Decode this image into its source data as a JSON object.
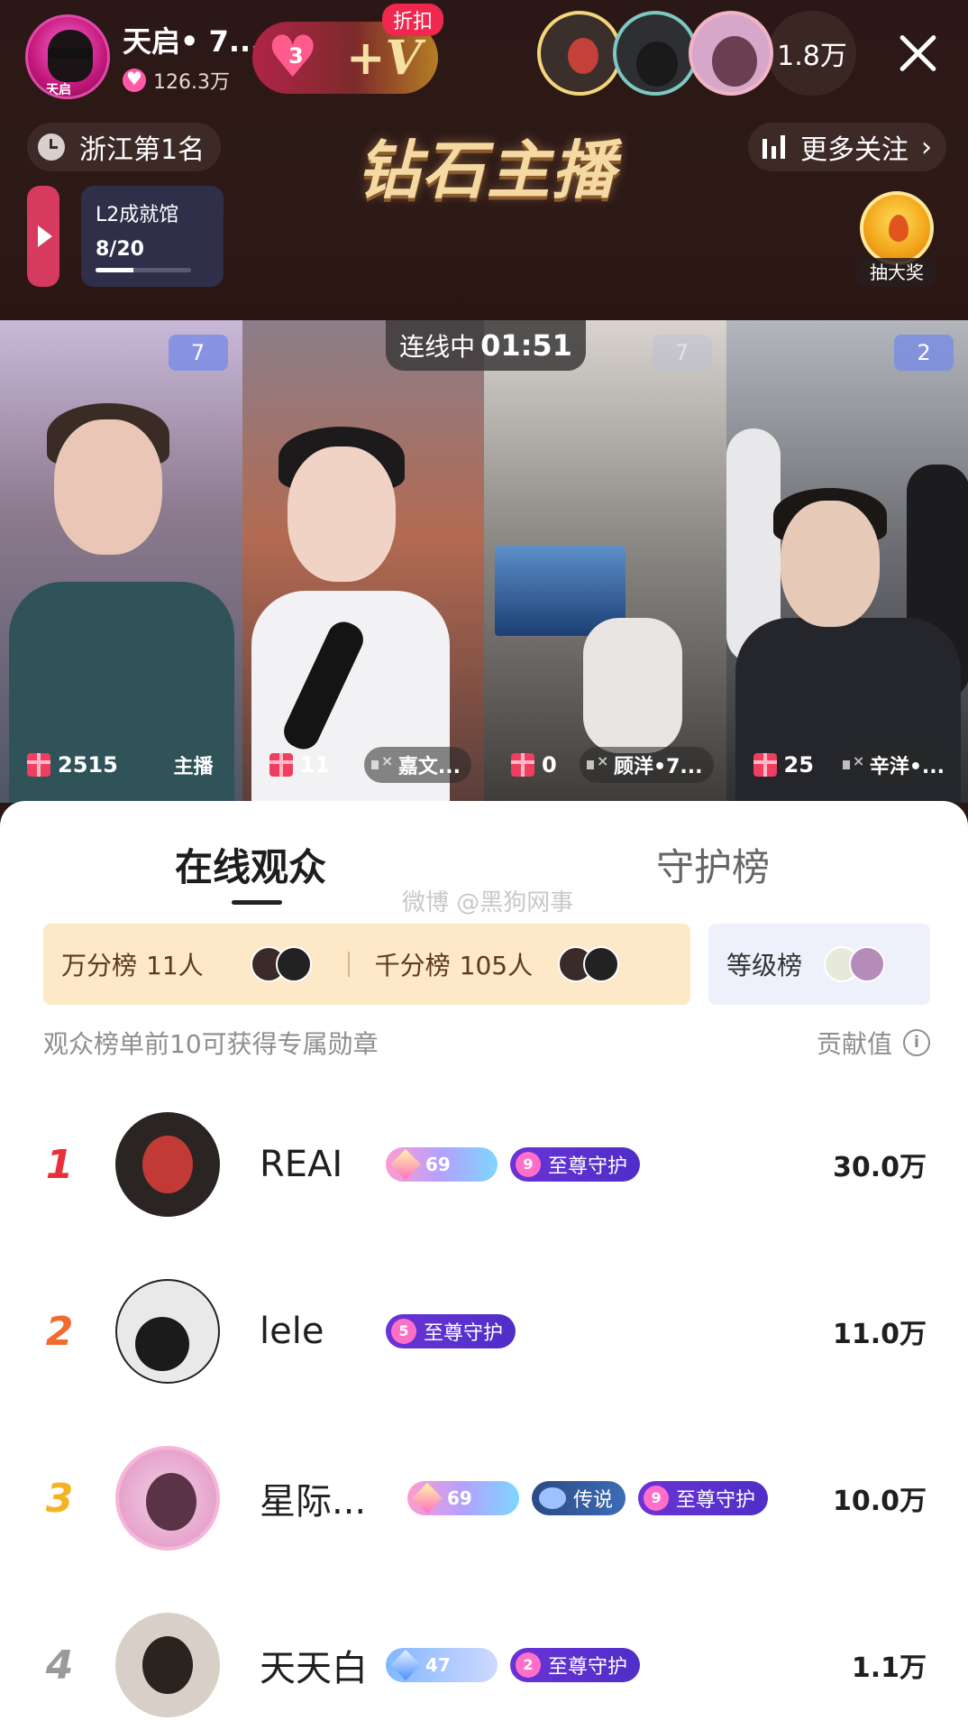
{
  "host": {
    "name": "天启• 7...",
    "likes": "126.3万",
    "avatar_label": "天启"
  },
  "fanclub": {
    "level": "3",
    "discount_label": "折扣"
  },
  "header": {
    "viewer_count": "1.8万",
    "rank_label": "浙江第1名",
    "center_title": "钻石主播",
    "follow_label": "更多关注"
  },
  "achievement": {
    "title": "L2成就馆",
    "progress_text": "8/20",
    "progress_fraction": 0.4
  },
  "lottery": {
    "label": "抽大奖"
  },
  "link": {
    "label": "连线中",
    "time": "01:51"
  },
  "cells": [
    {
      "slot": "7",
      "gifts": "2515",
      "name": "主播"
    },
    {
      "slot": "",
      "gifts": "11",
      "name": "嘉文..."
    },
    {
      "slot": "7",
      "gifts": "0",
      "name": "顾洋•7..."
    },
    {
      "slot": "2",
      "gifts": "25",
      "name": "辛洋•..."
    }
  ],
  "tabs": {
    "online": "在线观众",
    "guard": "守护榜"
  },
  "watermark": "微博 @黑狗网事",
  "boards": {
    "wan_label": "万分榜",
    "wan_count": "11人",
    "qian_label": "千分榜",
    "qian_count": "105人",
    "level_label": "等级榜"
  },
  "hint": "观众榜单前10可获得专属勋章",
  "contribution_label": "贡献值",
  "rows": [
    {
      "rank": "1",
      "name": "REAI",
      "level": "69",
      "legend": "",
      "guard_level": "9",
      "guard_label": "至尊守护",
      "score": "30.0万"
    },
    {
      "rank": "2",
      "name": "lele",
      "level": "",
      "legend": "",
      "guard_level": "5",
      "guard_label": "至尊守护",
      "score": "11.0万"
    },
    {
      "rank": "3",
      "name": "星际...",
      "level": "69",
      "legend": "传说",
      "guard_level": "9",
      "guard_label": "至尊守护",
      "score": "10.0万"
    },
    {
      "rank": "4",
      "name": "天天白",
      "level": "47",
      "legend": "",
      "guard_level": "2",
      "guard_label": "至尊守护",
      "score": "1.1万"
    }
  ],
  "colors": {
    "rank1": "#e8303a",
    "rank2": "#f26a2c",
    "rank3": "#f4b322",
    "rank4": "#9a9a9a",
    "accent": "#ff5aa8"
  }
}
